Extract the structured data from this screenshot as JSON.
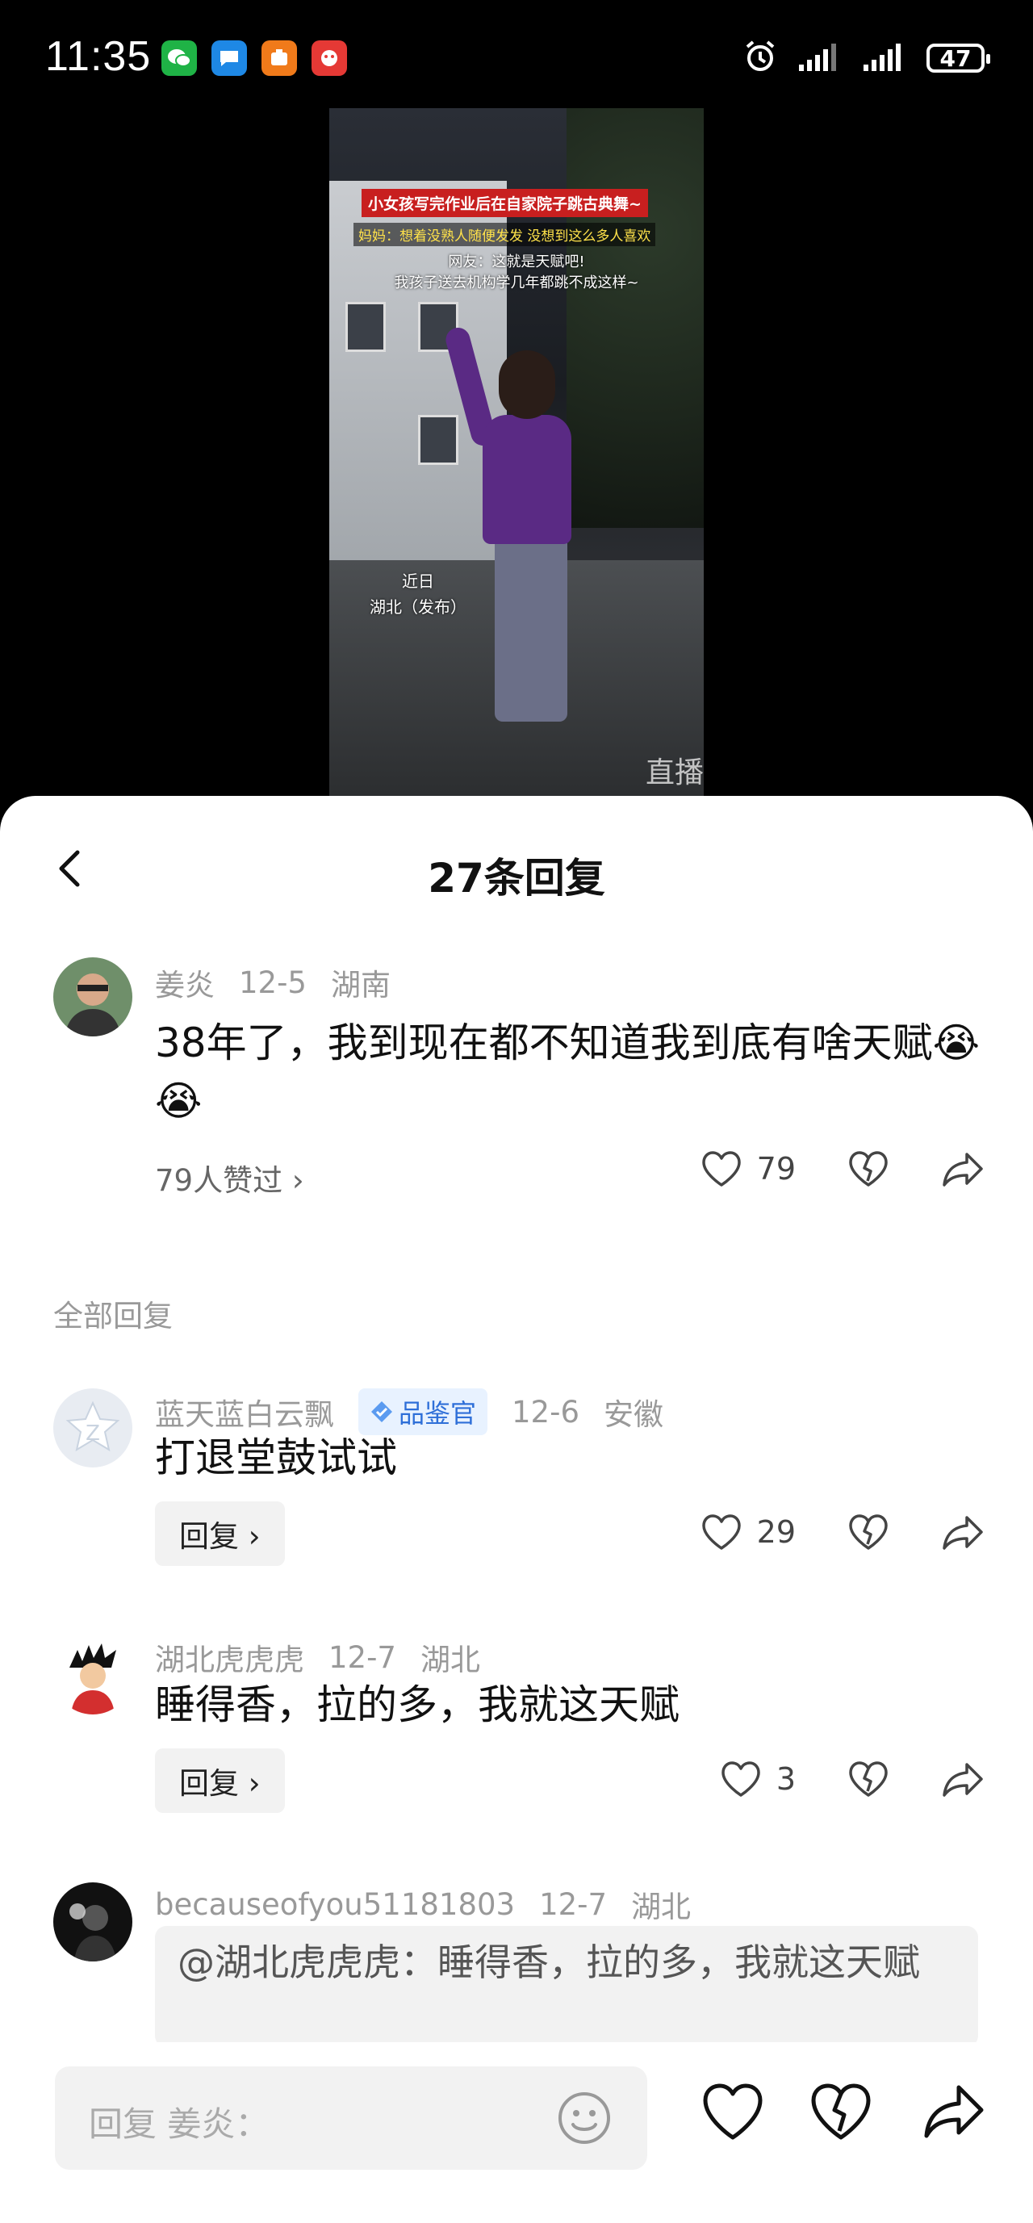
{
  "status_bar": {
    "time": "11:35",
    "battery": "47",
    "app_icons": [
      "wechat-icon",
      "message-icon",
      "orange-app-icon",
      "red-app-icon"
    ]
  },
  "video": {
    "caption_title": "小女孩写完作业后在自家院子跳古典舞~",
    "caption_mom": "妈妈：想着没熟人随便发发 没想到这么多人喜欢",
    "caption_netizen_1": "网友：这就是天赋吧!",
    "caption_netizen_2": "我孩子送去机构学几年都跳不成这样~",
    "caption_date": "近日",
    "caption_source": "湖北（发布）",
    "watermark": "直播"
  },
  "sheet": {
    "title": "27条回复"
  },
  "main_comment": {
    "author": "姜炎",
    "date": "12-5",
    "location": "湖南",
    "text": "38年了，我到现在都不知道我到底有啥天赋😭😭",
    "liked_by": "79人赞过 ›",
    "like_count": "79"
  },
  "section_label": "全部回复",
  "replies": [
    {
      "author": "蓝天蓝白云飘",
      "badge": "品鉴官",
      "date": "12-6",
      "location": "安徽",
      "text": "打退堂鼓试试",
      "reply_label": "回复 ›",
      "like_count": "29"
    },
    {
      "author": "湖北虎虎虎",
      "date": "12-7",
      "location": "湖北",
      "text": "睡得香，拉的多，我就这天赋",
      "reply_label": "回复 ›",
      "like_count": "3"
    },
    {
      "author": "becauseofyou51181803",
      "date": "12-7",
      "location": "湖北",
      "quote": "@湖北虎虎虎：睡得香，拉的多，我就这天赋"
    }
  ],
  "bottom_bar": {
    "placeholder": "回复 姜炎："
  },
  "colors": {
    "accent_blue": "#2e6fd8",
    "text_gray": "#999999",
    "video_caption_red": "#c81f1f"
  }
}
